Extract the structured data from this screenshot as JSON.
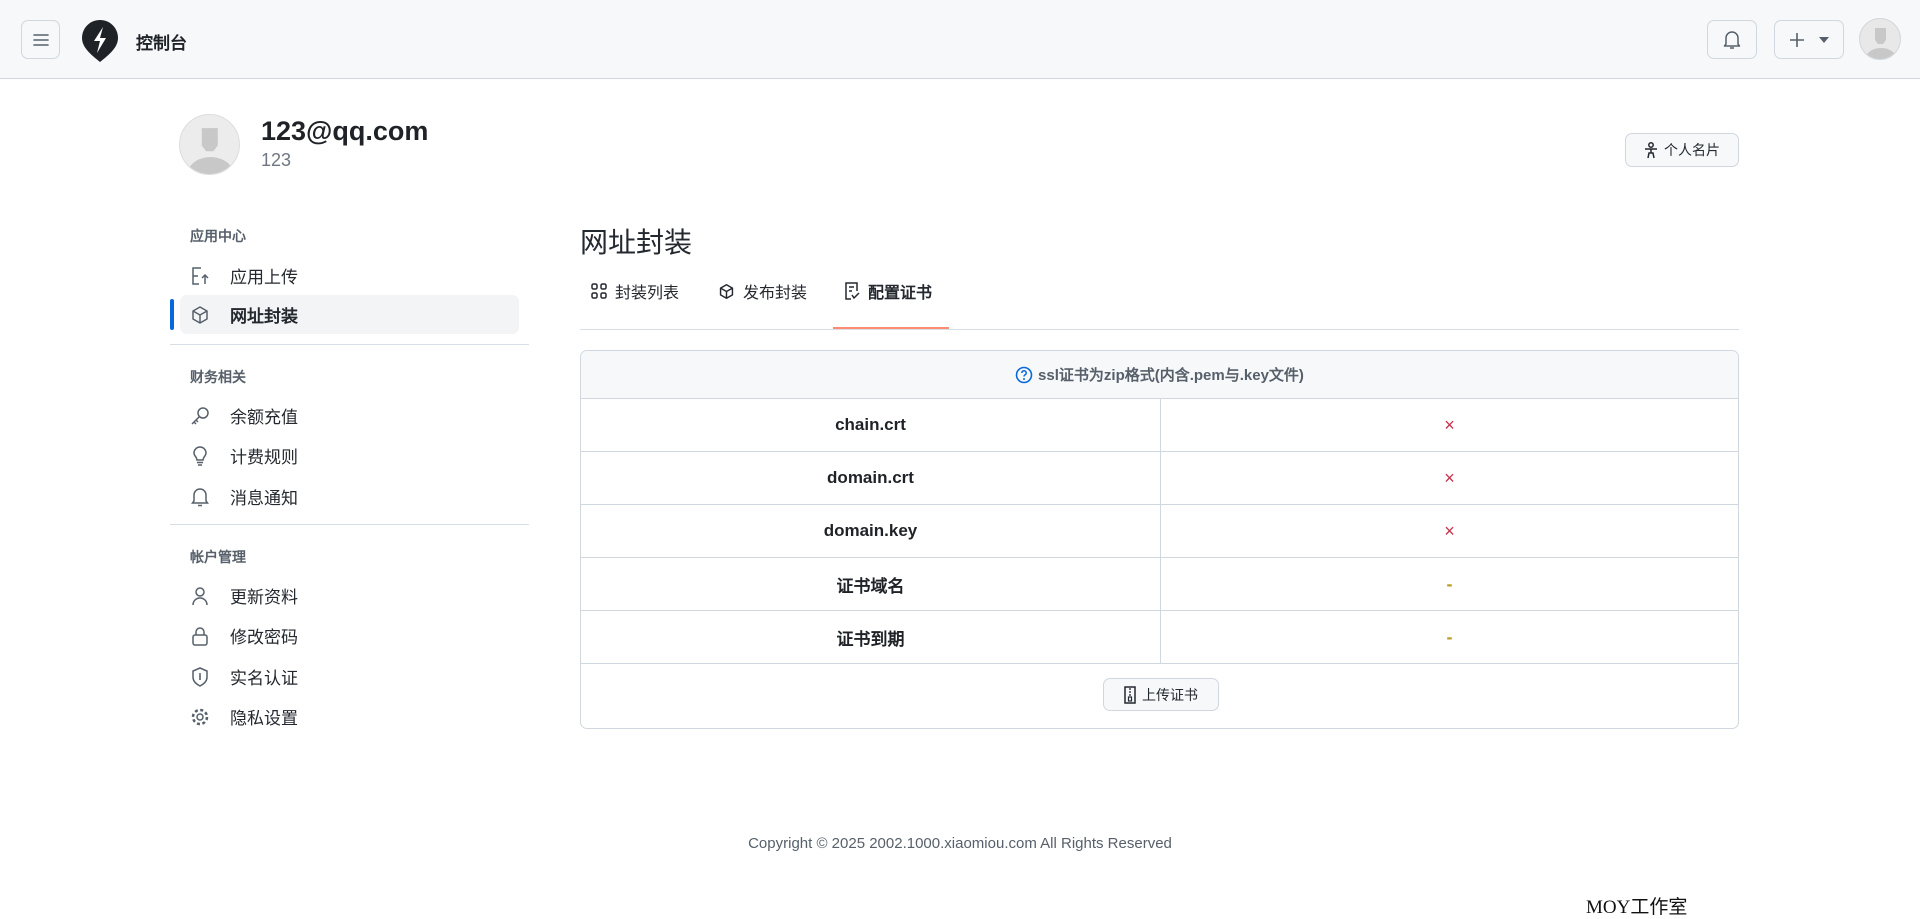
{
  "header": {
    "title": "控制台",
    "icons": [
      "menu-icon",
      "logo-bolt-icon",
      "bell-icon",
      "plus-icon",
      "caret-down-icon",
      "avatar"
    ]
  },
  "profile": {
    "email": "123@qq.com",
    "username": "123",
    "card_button": "个人名片"
  },
  "sidebar": {
    "sections": [
      {
        "label": "应用中心",
        "items": [
          {
            "label": "应用上传",
            "icon": "upload-file-icon"
          },
          {
            "label": "网址封装",
            "icon": "cube-icon",
            "active": true
          }
        ]
      },
      {
        "label": "财务相关",
        "items": [
          {
            "label": "余额充值",
            "icon": "key-icon"
          },
          {
            "label": "计费规则",
            "icon": "lightbulb-icon"
          },
          {
            "label": "消息通知",
            "icon": "bell-icon"
          }
        ]
      },
      {
        "label": "帐户管理",
        "items": [
          {
            "label": "更新资料",
            "icon": "person-icon"
          },
          {
            "label": "修改密码",
            "icon": "lock-icon"
          },
          {
            "label": "实名认证",
            "icon": "shield-icon"
          },
          {
            "label": "隐私设置",
            "icon": "gear-icon"
          }
        ]
      }
    ]
  },
  "main": {
    "title": "网址封装",
    "tabs": [
      {
        "label": "封装列表"
      },
      {
        "label": "发布封装"
      },
      {
        "label": "配置证书",
        "active": true
      }
    ],
    "table": {
      "header": "ssl证书为zip格式(内含.pem与.key文件)",
      "rows": [
        {
          "key": "chain.crt",
          "value": "×"
        },
        {
          "key": "domain.crt",
          "value": "×"
        },
        {
          "key": "domain.key",
          "value": "×"
        },
        {
          "key": "证书域名",
          "value": "-"
        },
        {
          "key": "证书到期",
          "value": "-"
        }
      ],
      "upload_button": "上传证书"
    }
  },
  "footer": {
    "copyright": "Copyright © 2025 2002.1000.xiaomiou.com All Rights Reserved",
    "watermark": "MOY工作室"
  },
  "colors": {
    "accent": "#0969da",
    "tab_underline": "#fd8c73",
    "missing": "#c9314b",
    "empty": "#b8a020"
  }
}
